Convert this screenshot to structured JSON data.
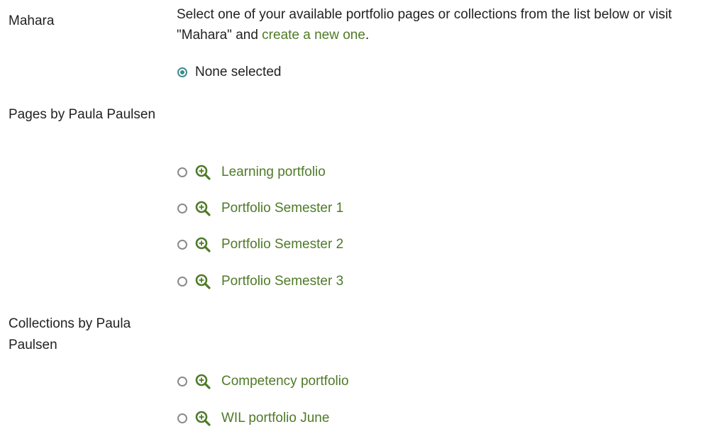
{
  "mahara_label": "Mahara",
  "intro": {
    "text_before": "Select one of your available portfolio pages or collections from the list below or visit \"Mahara\" and ",
    "link": "create a new one",
    "text_after": "."
  },
  "none_option": {
    "label": "None selected",
    "selected": true
  },
  "pages_section": {
    "heading": "Pages by Paula Paulsen",
    "items": [
      {
        "label": "Learning portfolio"
      },
      {
        "label": "Portfolio Semester 1"
      },
      {
        "label": "Portfolio Semester 2"
      },
      {
        "label": "Portfolio Semester 3"
      }
    ]
  },
  "collections_section": {
    "heading": "Collections by Paula Paulsen",
    "items": [
      {
        "label": "Competency portfolio"
      },
      {
        "label": "WIL portfolio June"
      }
    ]
  },
  "icons": {
    "preview": "magnifier-zoom-in-icon"
  },
  "colors": {
    "link": "#4f7a28",
    "radio_selected": "#3f8b8b",
    "text": "#222222"
  }
}
